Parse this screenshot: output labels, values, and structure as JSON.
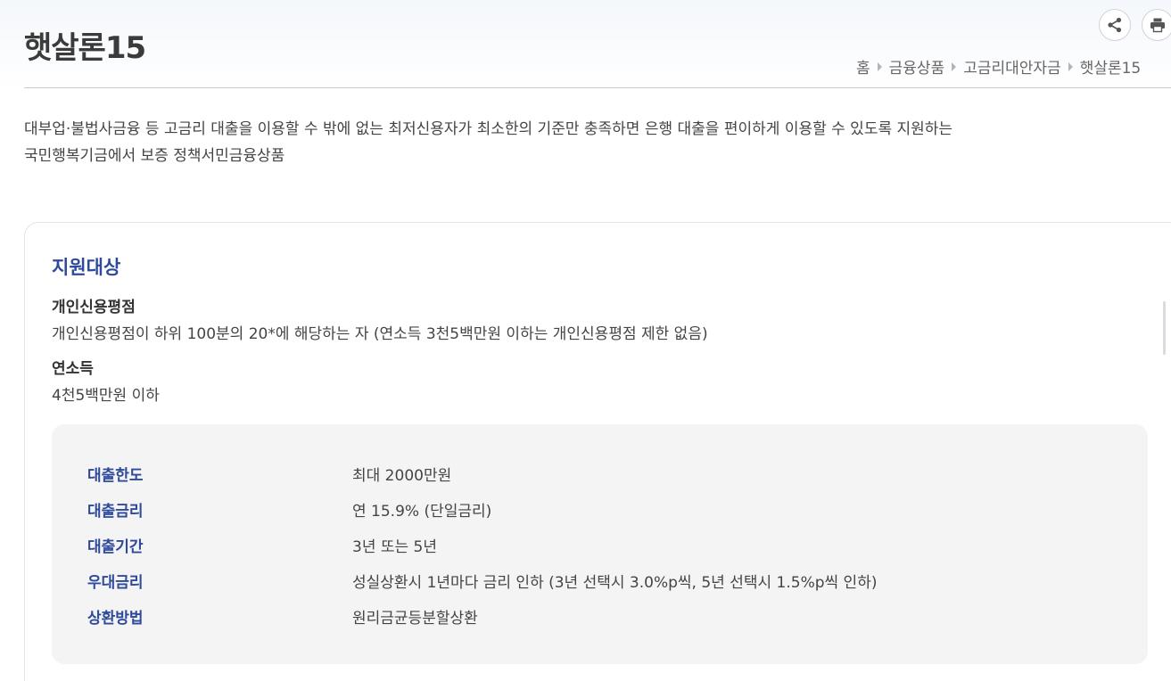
{
  "header": {
    "title": "햇살론15",
    "share_icon": "share-icon",
    "print_icon": "print-icon"
  },
  "breadcrumb": {
    "items": [
      "홈",
      "금융상품",
      "고금리대안자금",
      "햇살론15"
    ]
  },
  "intro": {
    "line1": "대부업·불법사금융 등 고금리 대출을 이용할 수 밖에 없는 최저신용자가 최소한의 기준만 충족하면 은행 대출을 편이하게 이용할 수 있도록 지원하는",
    "line2": "국민행복기금에서 보증 정책서민금융상품"
  },
  "eligibility": {
    "title": "지원대상",
    "criteria": [
      {
        "label": "개인신용평점",
        "value": "개인신용평점이 하위 100분의 20*에 해당하는 자 (연소득 3천5백만원 이하는 개인신용평점 제한 없음)"
      },
      {
        "label": "연소득",
        "value": "4천5백만원 이하"
      }
    ]
  },
  "loan_info": {
    "rows": [
      {
        "key": "대출한도",
        "value": "최대 2000만원"
      },
      {
        "key": "대출금리",
        "value": "연 15.9% (단일금리)"
      },
      {
        "key": "대출기간",
        "value": "3년 또는 5년"
      },
      {
        "key": "우대금리",
        "value": "성실상환시 1년마다 금리 인하 (3년 선택시 3.0%p씩, 5년 선택시 1.5%p씩 인하)"
      },
      {
        "key": "상환방법",
        "value": "원리금균등분할상환"
      }
    ]
  },
  "colors": {
    "accent": "#2f4a9a",
    "info_box_bg": "#f4f4f4"
  }
}
